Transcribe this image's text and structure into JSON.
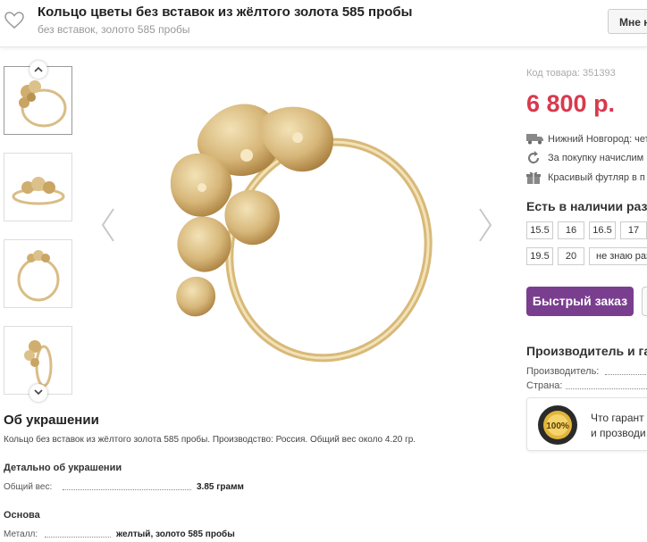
{
  "header": {
    "title": "Кольцо цветы без вставок из жёлтого золота 585 пробы",
    "subtitle": "без вставок, золото 585 пробы",
    "like_button": "Мне н"
  },
  "product": {
    "code": "Код товара: 351393",
    "price": "6 800 р.",
    "info": [
      {
        "icon": "delivery-truck-icon",
        "text": "Нижний Новгород: чет"
      },
      {
        "icon": "bonus-refresh-icon",
        "text": "За покупку начислим"
      },
      {
        "icon": "gift-box-icon",
        "text": "Красивый футляр в п"
      }
    ],
    "availability_title": "Есть в наличии разм",
    "sizes": [
      "15.5",
      "16",
      "16.5",
      "17",
      "19.5",
      "20",
      "не знаю раз"
    ],
    "quick_order": "Быстрый заказ"
  },
  "manufacturer": {
    "title": "Производитель и га",
    "producer_label": "Производитель:",
    "country_label": "Страна:",
    "guarantee_line1": "Что гарант",
    "guarantee_line2": "и прозводи",
    "seal_text": "100%"
  },
  "description": {
    "about_title": "Об украшении",
    "about_text": "Кольцо без вставок из жёлтого золота 585 пробы. Производство: Россия. Общий вес около 4.20 гр.",
    "details_title": "Детально об украшении",
    "weight_label": "Общий вес:",
    "weight_value": "3.85 грамм",
    "base_title": "Основа",
    "metal_label": "Металл:",
    "metal_value": "желтый, золото 585 пробы"
  },
  "colors": {
    "price": "#d9394d",
    "button": "#7a3e8f",
    "gold": "#d7b77a"
  }
}
